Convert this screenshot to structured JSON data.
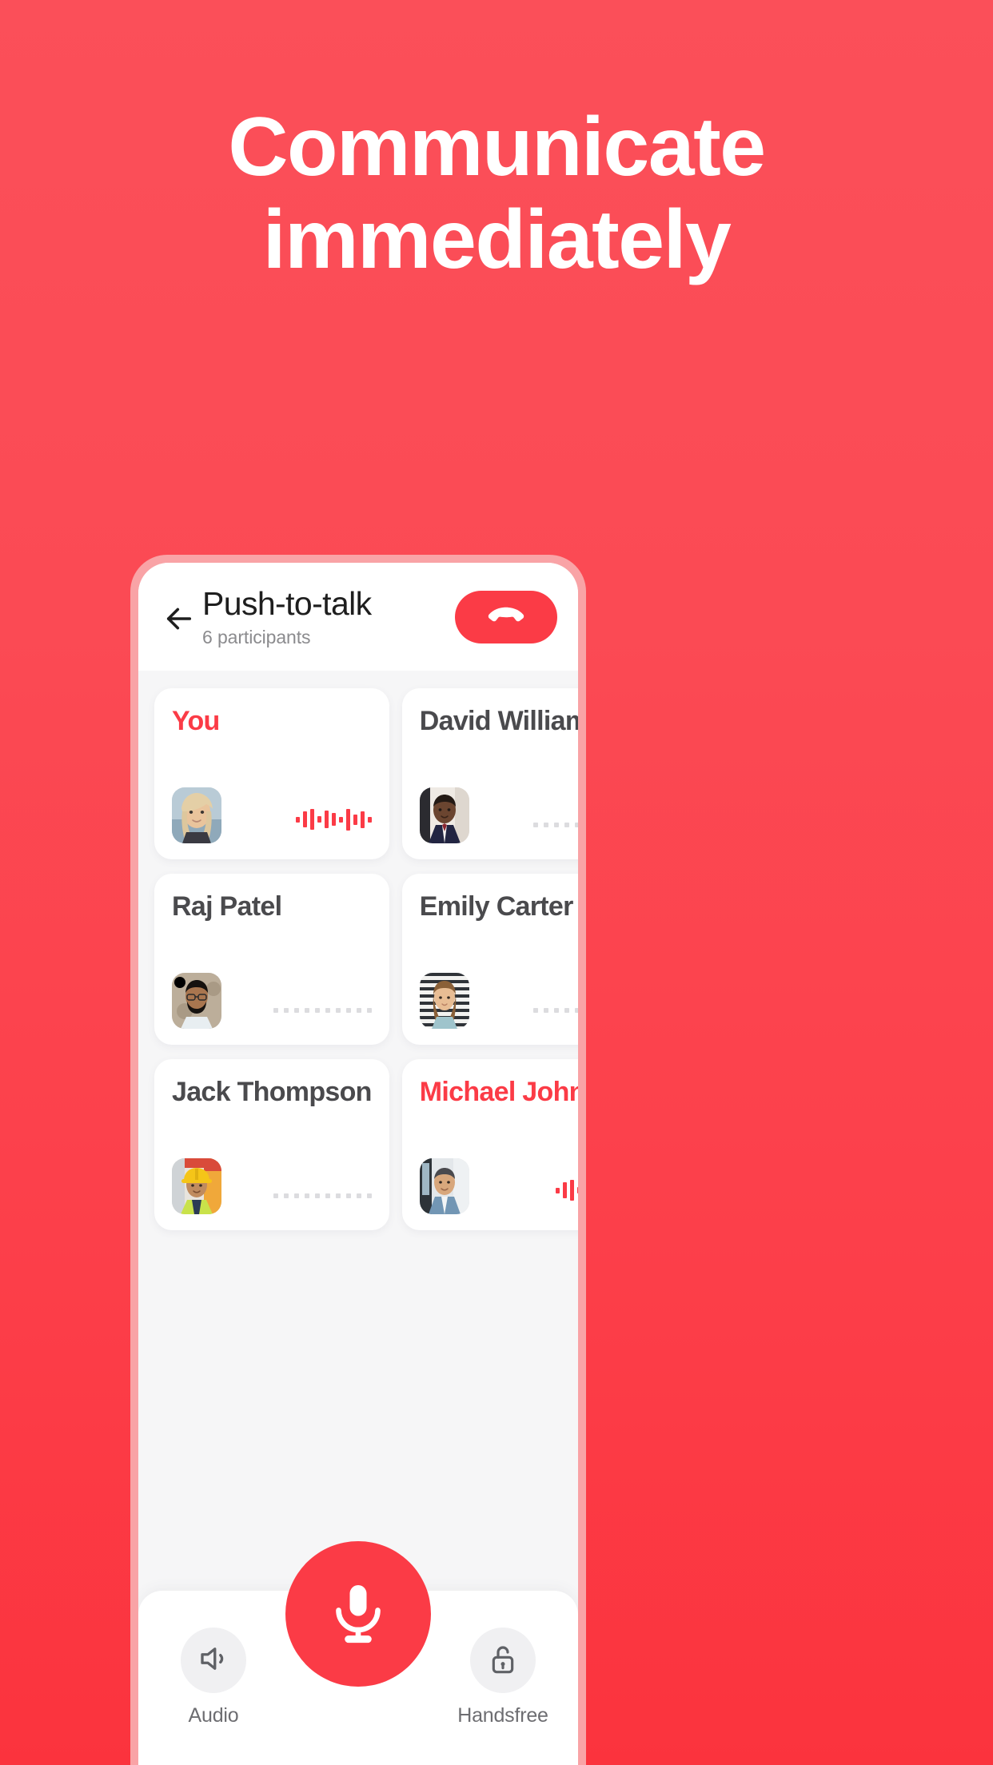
{
  "promo": {
    "headline_line1": "Communicate",
    "headline_line2": "immediately",
    "background_top_color": "#fb4f59",
    "background_bottom_color": "#fb333d"
  },
  "app": {
    "accent_color": "#fb3b46",
    "header": {
      "back_icon": "arrow-left-icon",
      "title": "Push-to-talk",
      "subtitle": "6 participants",
      "hangup_icon": "phone-hangup-icon"
    },
    "participants": [
      {
        "name": "You",
        "speaking": true,
        "indicator": "waveform",
        "avatar": "woman-blonde-avatar"
      },
      {
        "name": "David Williams",
        "speaking": false,
        "indicator": "dots",
        "avatar": "man-suit-avatar"
      },
      {
        "name": "Raj Patel",
        "speaking": false,
        "indicator": "dots",
        "avatar": "man-glasses-avatar"
      },
      {
        "name": "Emily Carter",
        "speaking": false,
        "indicator": "dots",
        "avatar": "woman-stripes-avatar"
      },
      {
        "name": "Jack Thompson",
        "speaking": false,
        "indicator": "dots",
        "avatar": "man-hardhat-avatar"
      },
      {
        "name": "Michael Johnson",
        "speaking": true,
        "indicator": "waveform",
        "avatar": "man-blazer-avatar"
      }
    ],
    "controls": {
      "audio_label": "Audio",
      "audio_icon": "speaker-icon",
      "mic_icon": "microphone-icon",
      "handsfree_label": "Handsfree",
      "handsfree_icon": "unlocked-padlock-icon"
    }
  }
}
